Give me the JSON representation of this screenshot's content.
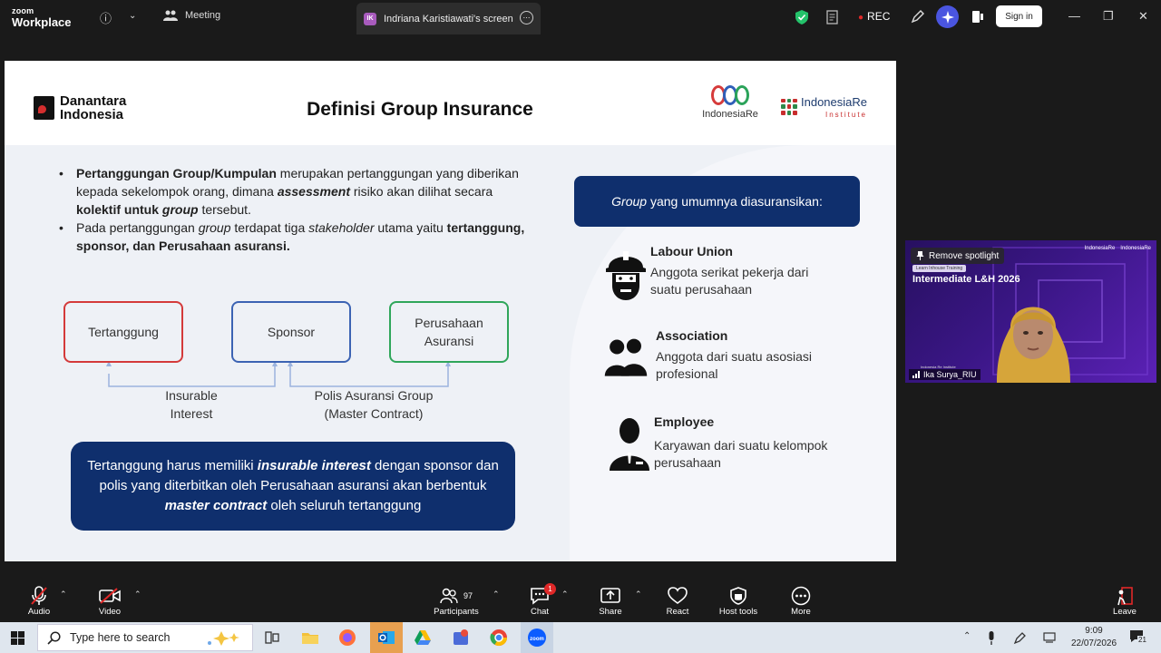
{
  "topbar": {
    "app_line1": "zoom",
    "app_line2": "Workplace",
    "meeting_label": "Meeting",
    "screen_tab_initials": "IK",
    "screen_tab_label": "Indriana Karistiawati's screen",
    "rec_label": "REC",
    "signin_label": "Sign in"
  },
  "slide": {
    "title": "Definisi Group Insurance",
    "logo_left_line1": "Danantara",
    "logo_left_line2": "Indonesia",
    "logo_mid": "IndonesiaRe",
    "logo_right": "IndonesiaRe",
    "logo_right_sub": "Institute",
    "bullets": [
      {
        "b1": "Pertanggungan Group/Kumpulan",
        "t1": " merupakan pertanggungan yang diberikan kepada sekelompok orang, dimana ",
        "i1": "assessment",
        "t2": " risiko akan dilihat secara ",
        "b2": "kolektif untuk ",
        "bi": "group",
        "t3": " tersebut."
      },
      {
        "t1": "Pada pertanggungan ",
        "i1": "group",
        "t2": " terdapat tiga ",
        "i2": "stakeholder",
        "t3": " utama yaitu ",
        "b1": "tertanggung, sponsor, dan Perusahaan asuransi."
      }
    ],
    "boxes": {
      "tertanggung": "Tertanggung",
      "sponsor": "Sponsor",
      "perusahaan_line1": "Perusahaan",
      "perusahaan_line2": "Asuransi"
    },
    "labels": {
      "insurable_line1": "Insurable",
      "insurable_line2": "Interest",
      "polis_line1": "Polis Asuransi Group",
      "polis_line2": "(Master Contract)"
    },
    "note": {
      "t1": "Tertanggung harus memiliki ",
      "i1": "insurable interest",
      "t2": " dengan sponsor dan polis yang diterbitkan oleh Perusahaan asuransi akan berbentuk ",
      "i2": "master contract",
      "t3": " oleh seluruh tertanggung"
    },
    "group_header": {
      "i1": "Group",
      "t1": " yang umumnya diasuransikan:"
    },
    "categories": [
      {
        "title": "Labour Union",
        "desc": "Anggota serikat pekerja dari suatu perusahaan"
      },
      {
        "title": "Association",
        "desc": "Anggota dari suatu asosiasi profesional"
      },
      {
        "title": "Employee",
        "desc": "Karyawan dari suatu kelompok perusahaan"
      }
    ],
    "colors": {
      "navy": "#0f2f6d",
      "red_box": "#d43a3a",
      "blue_box": "#3c63b3",
      "green_box": "#2fa65a"
    }
  },
  "video": {
    "spotlight_label": "Remove spotlight",
    "small_tag": "Learn Inhouse Training",
    "title": "Intermediate L&H 2026",
    "logo_a": "IndonesiaRe",
    "logo_b": "IndonesiaRe",
    "org_caption": "Indonesia Re Institute",
    "participant_name": "Ika Surya_RIU"
  },
  "bottombar": {
    "audio": "Audio",
    "video": "Video",
    "participants": "Participants",
    "participants_count": "97",
    "chat": "Chat",
    "chat_badge": "1",
    "share": "Share",
    "react": "React",
    "host_tools": "Host tools",
    "more": "More",
    "leave": "Leave"
  },
  "taskbar": {
    "search_placeholder": "Type here to search",
    "time": "9:09",
    "date": "22/07/2026",
    "notif_count": "21"
  }
}
